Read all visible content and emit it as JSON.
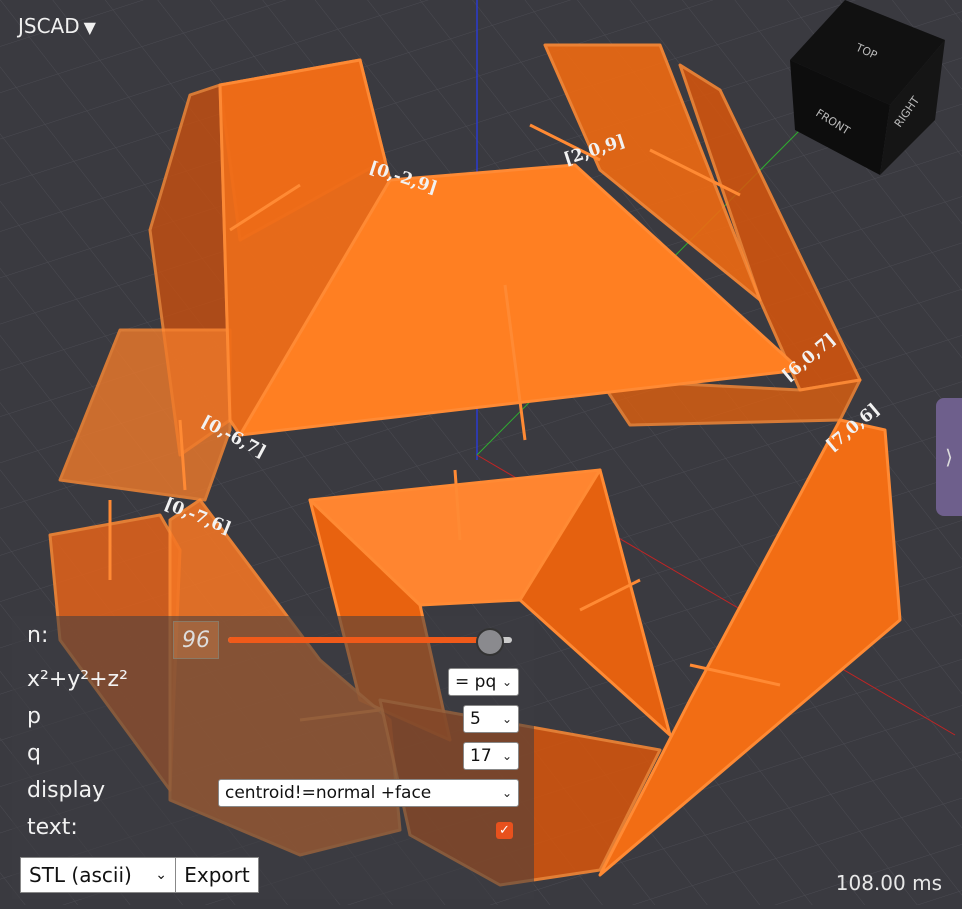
{
  "app": {
    "title": "JSCAD",
    "menu_caret": "▼"
  },
  "side_tab": {
    "icon": "⟩"
  },
  "view_cube": {
    "top": "TOP",
    "front": "FRONT",
    "right": "RIGHT"
  },
  "model_labels": [
    "[0,-2,9]",
    "[2,0,9]",
    "[6,0,7]",
    "[7,0,6]",
    "[0,-6,7]",
    "[0,-7,6]"
  ],
  "controls": {
    "n": {
      "label": "n:",
      "value": "96",
      "slider_fraction": 0.9
    },
    "equation": {
      "label": "x²+y²+z²",
      "value": "= pq"
    },
    "p": {
      "label": "p",
      "value": "5"
    },
    "q": {
      "label": "q",
      "value": "17"
    },
    "display": {
      "label": "display",
      "value": "centroid!=normal +face"
    },
    "text": {
      "label": "text:",
      "checked": true,
      "check_glyph": "✓"
    }
  },
  "export": {
    "format": "STL (ascii)",
    "button": "Export"
  },
  "render_time": "108.00 ms",
  "colors": {
    "face": "#ff7a1f",
    "face_dark": "#d9560c",
    "background": "#3a3a40",
    "accent": "#f05a1a"
  }
}
